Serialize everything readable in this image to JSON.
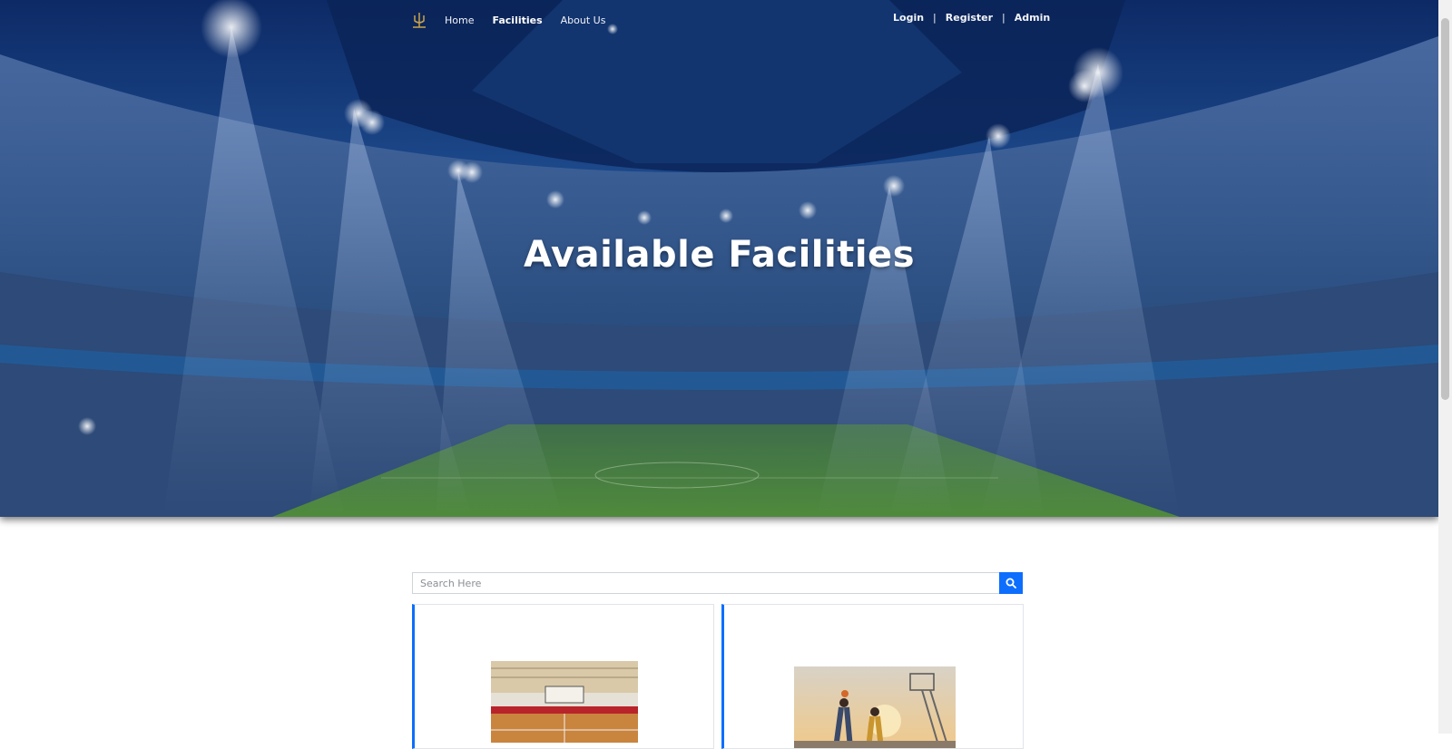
{
  "nav": {
    "logo_icon": "trident-logo-icon",
    "links": [
      {
        "label": "Home",
        "active": false
      },
      {
        "label": "Facilities",
        "active": true
      },
      {
        "label": "About Us",
        "active": false
      }
    ],
    "auth": {
      "login": "Login",
      "separator": "|",
      "register": "Register",
      "admin": "Admin"
    }
  },
  "hero": {
    "title": "Available Facilities",
    "background": "stadium-night-image"
  },
  "search": {
    "placeholder": "Search Here",
    "button_icon": "search-icon"
  },
  "facilities": [
    {
      "image": "indoor-gym-photo"
    },
    {
      "image": "outdoor-basketball-photo"
    }
  ],
  "colors": {
    "accent": "#0d6efd",
    "hero_overlay": "#123a7a",
    "nav_text": "#ffffff"
  }
}
